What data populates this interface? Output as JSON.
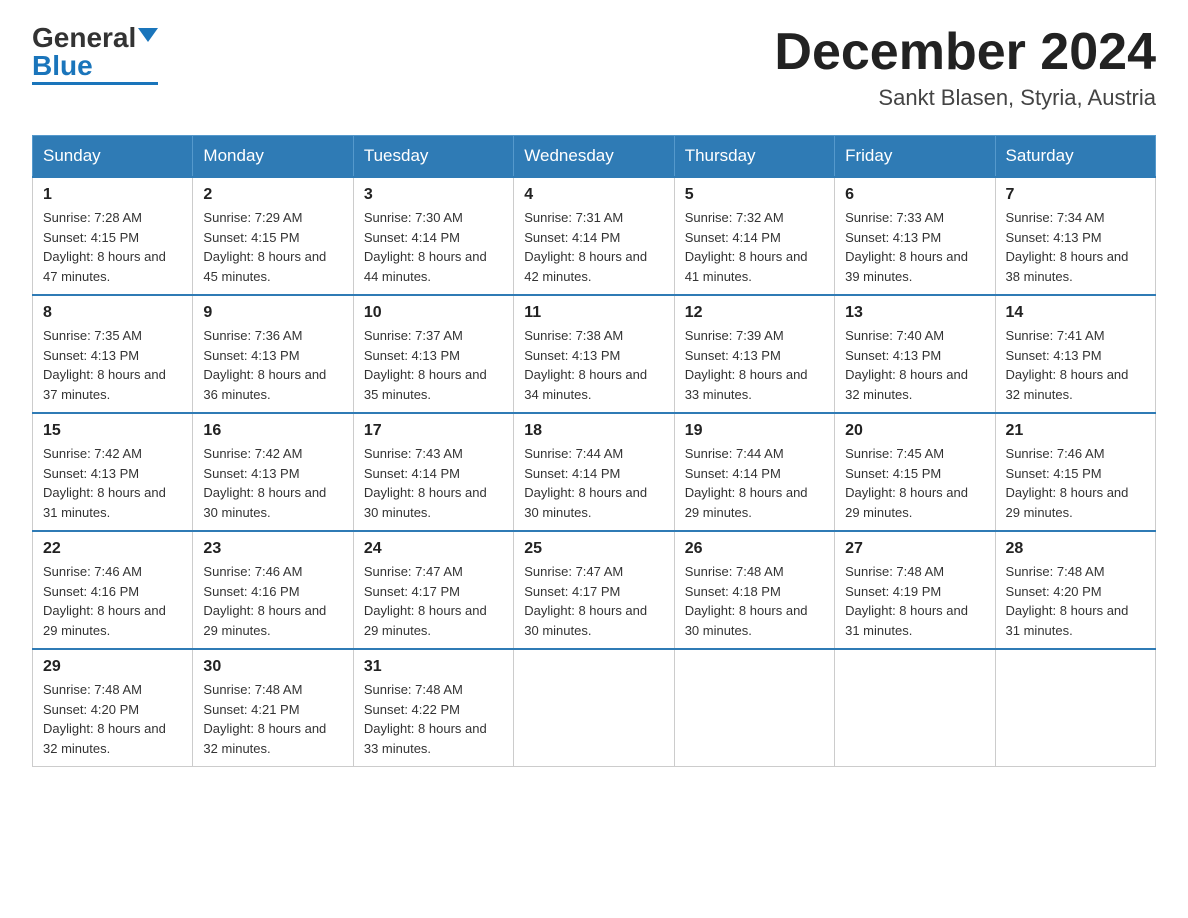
{
  "header": {
    "logo_general": "General",
    "logo_blue": "Blue",
    "month_title": "December 2024",
    "location": "Sankt Blasen, Styria, Austria"
  },
  "days_of_week": [
    "Sunday",
    "Monday",
    "Tuesday",
    "Wednesday",
    "Thursday",
    "Friday",
    "Saturday"
  ],
  "weeks": [
    [
      {
        "day": "1",
        "sunrise": "7:28 AM",
        "sunset": "4:15 PM",
        "daylight": "8 hours and 47 minutes."
      },
      {
        "day": "2",
        "sunrise": "7:29 AM",
        "sunset": "4:15 PM",
        "daylight": "8 hours and 45 minutes."
      },
      {
        "day": "3",
        "sunrise": "7:30 AM",
        "sunset": "4:14 PM",
        "daylight": "8 hours and 44 minutes."
      },
      {
        "day": "4",
        "sunrise": "7:31 AM",
        "sunset": "4:14 PM",
        "daylight": "8 hours and 42 minutes."
      },
      {
        "day": "5",
        "sunrise": "7:32 AM",
        "sunset": "4:14 PM",
        "daylight": "8 hours and 41 minutes."
      },
      {
        "day": "6",
        "sunrise": "7:33 AM",
        "sunset": "4:13 PM",
        "daylight": "8 hours and 39 minutes."
      },
      {
        "day": "7",
        "sunrise": "7:34 AM",
        "sunset": "4:13 PM",
        "daylight": "8 hours and 38 minutes."
      }
    ],
    [
      {
        "day": "8",
        "sunrise": "7:35 AM",
        "sunset": "4:13 PM",
        "daylight": "8 hours and 37 minutes."
      },
      {
        "day": "9",
        "sunrise": "7:36 AM",
        "sunset": "4:13 PM",
        "daylight": "8 hours and 36 minutes."
      },
      {
        "day": "10",
        "sunrise": "7:37 AM",
        "sunset": "4:13 PM",
        "daylight": "8 hours and 35 minutes."
      },
      {
        "day": "11",
        "sunrise": "7:38 AM",
        "sunset": "4:13 PM",
        "daylight": "8 hours and 34 minutes."
      },
      {
        "day": "12",
        "sunrise": "7:39 AM",
        "sunset": "4:13 PM",
        "daylight": "8 hours and 33 minutes."
      },
      {
        "day": "13",
        "sunrise": "7:40 AM",
        "sunset": "4:13 PM",
        "daylight": "8 hours and 32 minutes."
      },
      {
        "day": "14",
        "sunrise": "7:41 AM",
        "sunset": "4:13 PM",
        "daylight": "8 hours and 32 minutes."
      }
    ],
    [
      {
        "day": "15",
        "sunrise": "7:42 AM",
        "sunset": "4:13 PM",
        "daylight": "8 hours and 31 minutes."
      },
      {
        "day": "16",
        "sunrise": "7:42 AM",
        "sunset": "4:13 PM",
        "daylight": "8 hours and 30 minutes."
      },
      {
        "day": "17",
        "sunrise": "7:43 AM",
        "sunset": "4:14 PM",
        "daylight": "8 hours and 30 minutes."
      },
      {
        "day": "18",
        "sunrise": "7:44 AM",
        "sunset": "4:14 PM",
        "daylight": "8 hours and 30 minutes."
      },
      {
        "day": "19",
        "sunrise": "7:44 AM",
        "sunset": "4:14 PM",
        "daylight": "8 hours and 29 minutes."
      },
      {
        "day": "20",
        "sunrise": "7:45 AM",
        "sunset": "4:15 PM",
        "daylight": "8 hours and 29 minutes."
      },
      {
        "day": "21",
        "sunrise": "7:46 AM",
        "sunset": "4:15 PM",
        "daylight": "8 hours and 29 minutes."
      }
    ],
    [
      {
        "day": "22",
        "sunrise": "7:46 AM",
        "sunset": "4:16 PM",
        "daylight": "8 hours and 29 minutes."
      },
      {
        "day": "23",
        "sunrise": "7:46 AM",
        "sunset": "4:16 PM",
        "daylight": "8 hours and 29 minutes."
      },
      {
        "day": "24",
        "sunrise": "7:47 AM",
        "sunset": "4:17 PM",
        "daylight": "8 hours and 29 minutes."
      },
      {
        "day": "25",
        "sunrise": "7:47 AM",
        "sunset": "4:17 PM",
        "daylight": "8 hours and 30 minutes."
      },
      {
        "day": "26",
        "sunrise": "7:48 AM",
        "sunset": "4:18 PM",
        "daylight": "8 hours and 30 minutes."
      },
      {
        "day": "27",
        "sunrise": "7:48 AM",
        "sunset": "4:19 PM",
        "daylight": "8 hours and 31 minutes."
      },
      {
        "day": "28",
        "sunrise": "7:48 AM",
        "sunset": "4:20 PM",
        "daylight": "8 hours and 31 minutes."
      }
    ],
    [
      {
        "day": "29",
        "sunrise": "7:48 AM",
        "sunset": "4:20 PM",
        "daylight": "8 hours and 32 minutes."
      },
      {
        "day": "30",
        "sunrise": "7:48 AM",
        "sunset": "4:21 PM",
        "daylight": "8 hours and 32 minutes."
      },
      {
        "day": "31",
        "sunrise": "7:48 AM",
        "sunset": "4:22 PM",
        "daylight": "8 hours and 33 minutes."
      },
      null,
      null,
      null,
      null
    ]
  ]
}
